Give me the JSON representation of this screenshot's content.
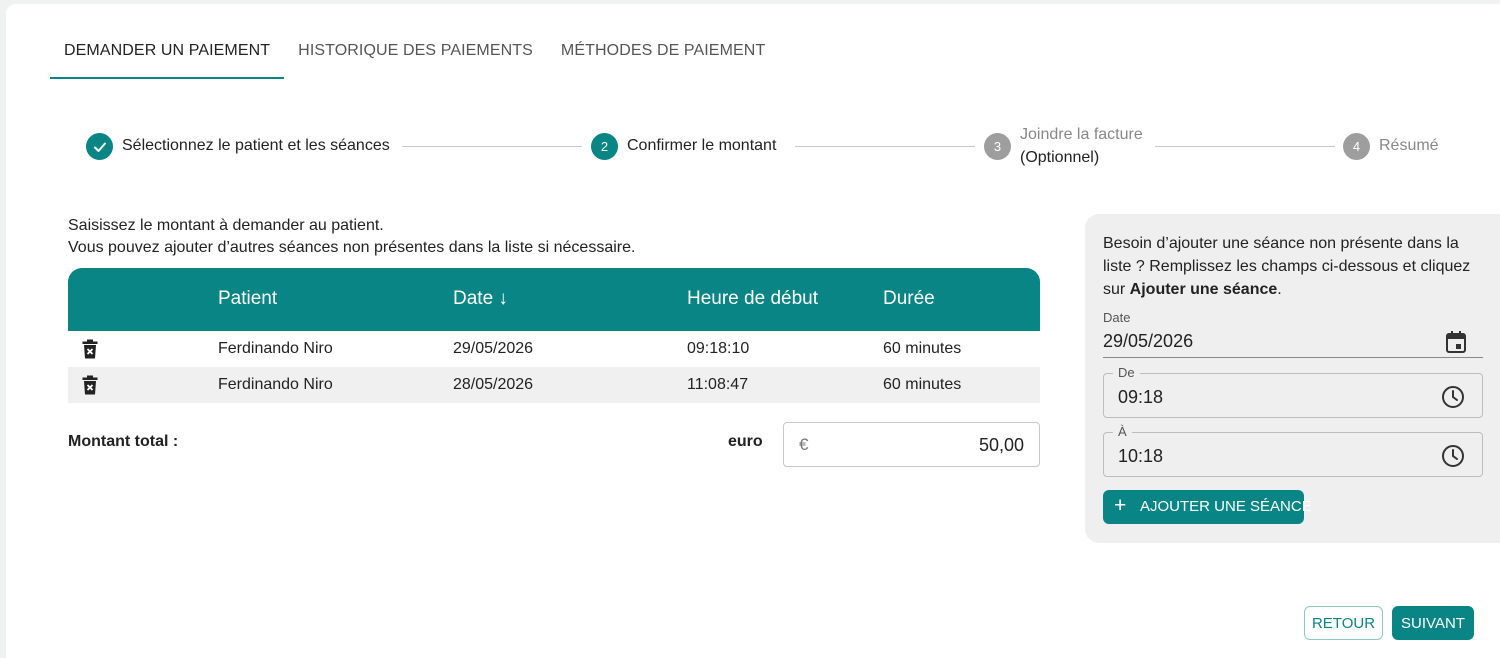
{
  "tabs": [
    {
      "label": "DEMANDER UN PAIEMENT"
    },
    {
      "label": "HISTORIQUE DES PAIEMENTS"
    },
    {
      "label": "MÉTHODES DE PAIEMENT"
    }
  ],
  "stepper": {
    "steps": [
      {
        "number": "",
        "label": "Sélectionnez le patient et les séances",
        "state": "done"
      },
      {
        "number": "2",
        "label": "Confirmer le montant",
        "state": "active"
      },
      {
        "number": "3",
        "label": "Joindre la facture",
        "sublabel": "(Optionnel)",
        "state": "pending"
      },
      {
        "number": "4",
        "label": "Résumé",
        "state": "pending"
      }
    ]
  },
  "intro": {
    "line1": "Saisissez le montant à demander au patient.",
    "line2": "Vous pouvez ajouter d’autres séances non présentes dans la liste si nécessaire."
  },
  "table": {
    "headers": {
      "patient": "Patient",
      "date": "Date ↓",
      "start": "Heure de début",
      "duration": "Durée"
    },
    "rows": [
      {
        "patient": "Ferdinando Niro",
        "date": "29/05/2026",
        "start": "09:18:10",
        "duration": "60 minutes"
      },
      {
        "patient": "Ferdinando Niro",
        "date": "28/05/2026",
        "start": "11:08:47",
        "duration": "60 minutes"
      }
    ]
  },
  "total": {
    "label": "Montant total :",
    "currency_label": "euro",
    "currency_symbol": "€",
    "value": "50,00"
  },
  "panel": {
    "text_before": "Besoin d’ajouter une séance non présente dans la liste ? Remplissez les champs ci-dessous et cliquez sur ",
    "text_bold": "Ajouter une séance",
    "text_after": ".",
    "date_label": "Date",
    "date_value": "29/05/2026",
    "from_label": "De",
    "from_value": "09:18",
    "to_label": "À",
    "to_value": "10:18",
    "add_button": "AJOUTER UNE SÉANCE"
  },
  "footer": {
    "back": "RETOUR",
    "next": "SUIVANT"
  },
  "colors": {
    "accent": "#0a8585",
    "pending": "#9e9e9e"
  }
}
